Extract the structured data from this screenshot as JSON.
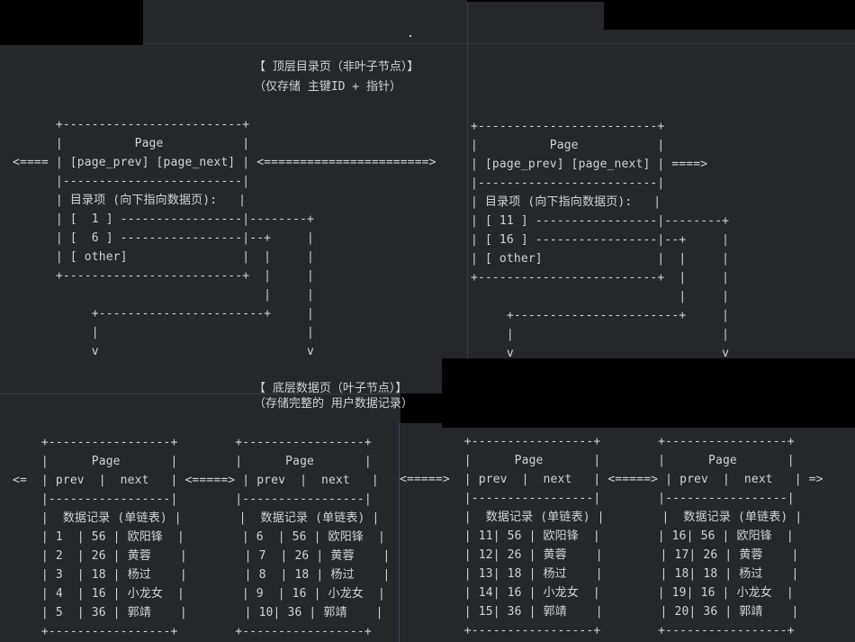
{
  "top_section": {
    "title": "【 顶层目录页（非叶子节点）】",
    "subtitle": "（仅存储 主键ID + 指针）"
  },
  "bottom_section": {
    "title": "【 底层数据页（叶子节点）】",
    "subtitle": "（存储完整的 用户数据记录）"
  },
  "top_left_diagram": "      +-------------------------+\n      |          Page           |\n<==== | [page_prev] [page_next] | <=======================>\n      |-------------------------|\n      | 目录项 (向下指向数据页):   |\n      | [  1 ] -----------------|--------+\n      | [  6 ] -----------------|--+     |\n      | [ other]                |  |     |\n      +-------------------------+  |     |\n                                   |     |\n           +-----------------------+     |\n           |                             |\n           v                             v",
  "top_right_diagram": "+-------------------------+\n|          Page           |\n| [page_prev] [page_next] | ====>\n|-------------------------|\n| 目录项 (向下指向数据页):   |\n| [ 11 ] -----------------|--------+\n| [ 16 ] -----------------|--+     |\n| [ other]                |  |     |\n+-------------------------+  |     |\n                             |     |\n     +-----------------------+     |\n     |                             |\n     v                             v",
  "bottom_left_diagram": "    +-----------------+        +-----------------+\n    |      Page       |        |      Page       |\n<=  | prev  |  next   | <=====> | prev  |  next   |\n    |-----------------|        |-----------------|\n    |  数据记录 (单链表) |        |  数据记录 (单链表) |\n    | 1  | 56 | 欧阳锋  |        | 6  | 56 | 欧阳锋  |\n    | 2  | 26 | 黄蓉    |        | 7  | 26 | 黄蓉    |\n    | 3  | 18 | 杨过    |        | 8  | 18 | 杨过    |\n    | 4  | 16 | 小龙女  |        | 9  | 16 | 小龙女  |\n    | 5  | 36 | 郭靖    |        | 10| 36 | 郭靖    |\n    +-----------------+        +-----------------+",
  "bottom_right_diagram": "         +-----------------+        +-----------------+\n         |      Page       |        |      Page       |\n<=====>  | prev  |  next   | <=====> | prev  |  next   | =>\n         |-----------------|        |-----------------|\n         |  数据记录 (单链表) |        |  数据记录 (单链表) |\n         | 11| 56 | 欧阳锋  |        | 16| 56 | 欧阳锋  |\n         | 12| 26 | 黄蓉    |        | 17| 26 | 黄蓉    |\n         | 13| 18 | 杨过    |        | 18| 18 | 杨过    |\n         | 14| 16 | 小龙女  |        | 19| 16 | 小龙女  |\n         | 15| 36 | 郭靖    |        | 20| 36 | 郭靖    |\n         +-----------------+        +-----------------+",
  "colors": {
    "background": "#25272b",
    "text": "#d3d3d3",
    "mask": "#000000",
    "selection_border": "#2b4a74"
  }
}
